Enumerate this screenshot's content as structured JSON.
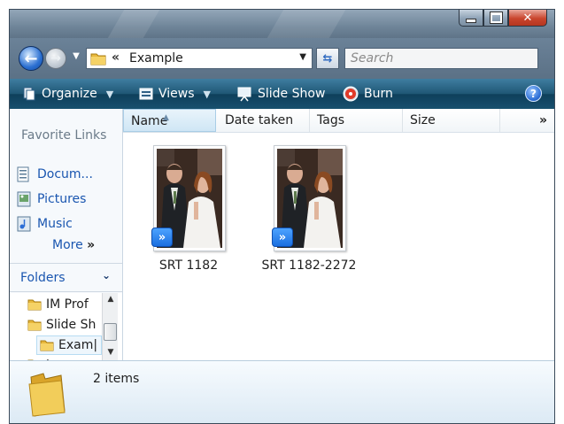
{
  "address": {
    "chevron": "«",
    "path": "Example",
    "dropdown_icon": "chevron-down-icon"
  },
  "search": {
    "placeholder": "Search"
  },
  "toolbar": {
    "organize": "Organize",
    "views": "Views",
    "slideshow": "Slide Show",
    "burn": "Burn",
    "help": "?"
  },
  "nav": {
    "favorites_heading": "Favorite Links",
    "links": [
      {
        "label": "Docum...",
        "icon": "documents-icon"
      },
      {
        "label": "Pictures",
        "icon": "pictures-icon"
      },
      {
        "label": "Music",
        "icon": "music-icon"
      }
    ],
    "more": "More",
    "more_glyph": "»",
    "folders_heading": "Folders",
    "tree": [
      {
        "label": "IM Prof"
      },
      {
        "label": "Slide Sh"
      },
      {
        "label": "Exam|"
      },
      {
        "label": "temp"
      }
    ]
  },
  "columns": [
    "Name",
    "Date taken",
    "Tags",
    "Size"
  ],
  "columns_more": "»",
  "items": [
    {
      "name": "SRT  1182",
      "badge": "»"
    },
    {
      "name": "SRT  1182-2272",
      "badge": "»"
    }
  ],
  "details": {
    "count": "2 items"
  },
  "colors": {
    "toolbar": "#1f5775",
    "link": "#1a56b0",
    "close": "#c9452d",
    "badge": "#1b6fe0"
  }
}
